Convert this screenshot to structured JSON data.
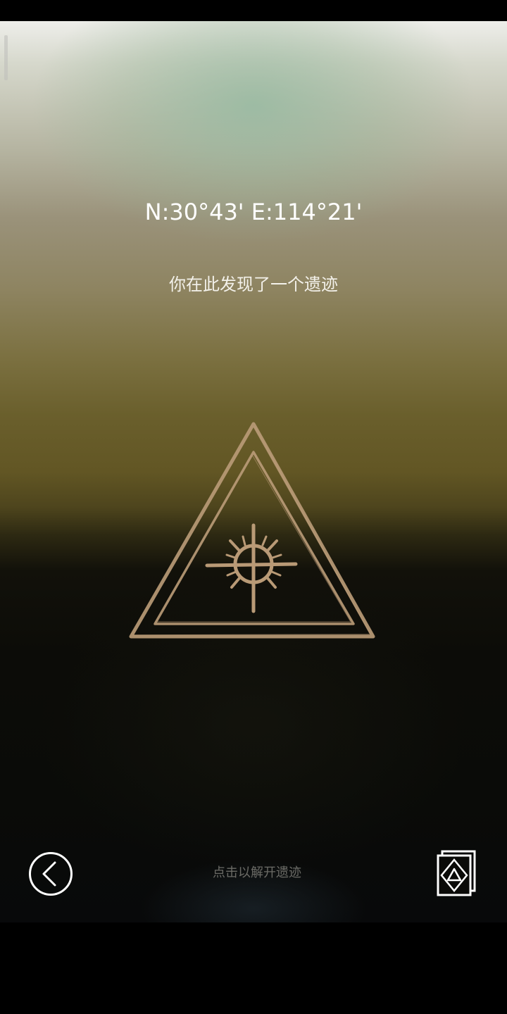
{
  "location": {
    "coordinates": "N:30°43' E:114°21'",
    "message": "你在此发现了一个遗迹"
  },
  "relic": {
    "icon": "triangle-sun-rune-icon",
    "color": "#b99a76"
  },
  "controls": {
    "back_icon": "back-chevron-icon",
    "hint": "点击以解开遗迹",
    "cards_icon": "relic-cards-icon"
  },
  "colors": {
    "sky_top": "#eeeeea",
    "horizon_gold": "#6a5f2c",
    "ground_dark": "#0a0b08",
    "text_primary": "#ffffff",
    "text_hint": "#6b6b66"
  }
}
